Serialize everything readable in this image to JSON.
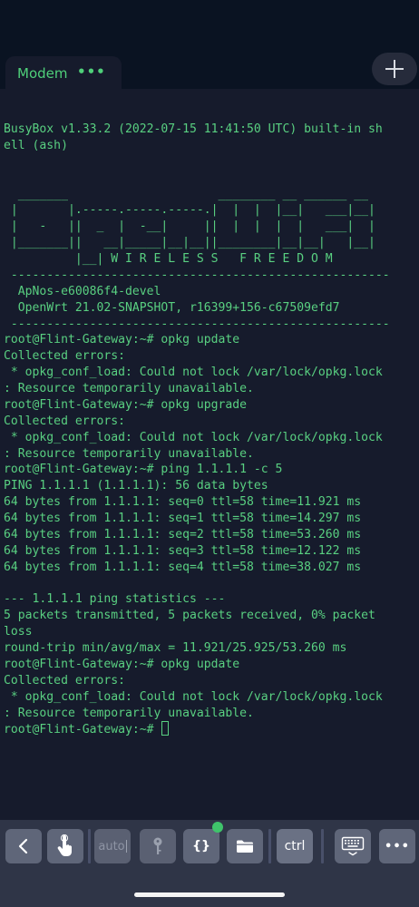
{
  "tabs": {
    "active_label": "Modem",
    "menu_label": "•••"
  },
  "terminal": {
    "lines": [
      "BusyBox v1.33.2 (2022-07-15 11:41:50 UTC) built-in sh",
      "ell (ash)",
      "",
      "",
      "  _______                     ________ __ ______ __",
      " |       |.-----.-----.-----.|  |  |  |__|   ___|__|",
      " |   -   ||  _  |  -__|     ||  |  |  |  |   ___|  |",
      " |_______||   __|_____|__|__||________|__|__|   |__|",
      "          |__| W I R E L E S S   F R E E D O M",
      " -----------------------------------------------------",
      "  ApNos-e60086f4-devel",
      "  OpenWrt 21.02-SNAPSHOT, r16399+156-c67509efd7",
      " -----------------------------------------------------",
      "root@Flint-Gateway:~# opkg update",
      "Collected errors:",
      " * opkg_conf_load: Could not lock /var/lock/opkg.lock",
      ": Resource temporarily unavailable.",
      "root@Flint-Gateway:~# opkg upgrade",
      "Collected errors:",
      " * opkg_conf_load: Could not lock /var/lock/opkg.lock",
      ": Resource temporarily unavailable.",
      "root@Flint-Gateway:~# ping 1.1.1.1 -c 5",
      "PING 1.1.1.1 (1.1.1.1): 56 data bytes",
      "64 bytes from 1.1.1.1: seq=0 ttl=58 time=11.921 ms",
      "64 bytes from 1.1.1.1: seq=1 ttl=58 time=14.297 ms",
      "64 bytes from 1.1.1.1: seq=2 ttl=58 time=53.260 ms",
      "64 bytes from 1.1.1.1: seq=3 ttl=58 time=12.122 ms",
      "64 bytes from 1.1.1.1: seq=4 ttl=58 time=38.027 ms",
      "",
      "--- 1.1.1.1 ping statistics ---",
      "5 packets transmitted, 5 packets received, 0% packet",
      "loss",
      "round-trip min/avg/max = 11.921/25.925/53.260 ms",
      "root@Flint-Gateway:~# opkg update",
      "Collected errors:",
      " * opkg_conf_load: Could not lock /var/lock/opkg.lock",
      ": Resource temporarily unavailable."
    ],
    "prompt": "root@Flint-Gateway:~# "
  },
  "toolbar": {
    "auto_label": "auto",
    "braces_label": "{}",
    "ctrl_label": "ctrl",
    "more_label": "•••",
    "icons": [
      "chevron-left-icon",
      "touch-hand-icon",
      "key-icon",
      "folder-icon",
      "keyboard-hide-icon"
    ]
  },
  "colors": {
    "terminal_text": "#59d081",
    "terminal_background": "#161b2c",
    "status_dot": "#3fc46b"
  }
}
